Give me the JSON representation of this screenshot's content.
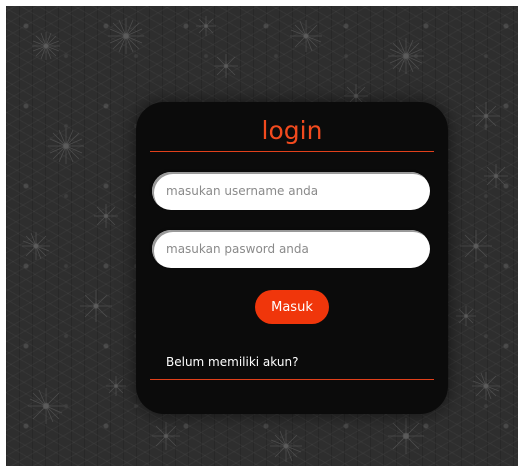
{
  "login_form": {
    "title": "login",
    "username_placeholder": "masukan username anda",
    "password_placeholder": "masukan pasword anda",
    "submit_label": "Masuk",
    "signup_link": "Belum memiliki akun?"
  },
  "colors": {
    "accent": "#f0360b",
    "title": "#f24a1e",
    "card_background": "#0b0b0b",
    "page_background": "#2e2e2e"
  }
}
